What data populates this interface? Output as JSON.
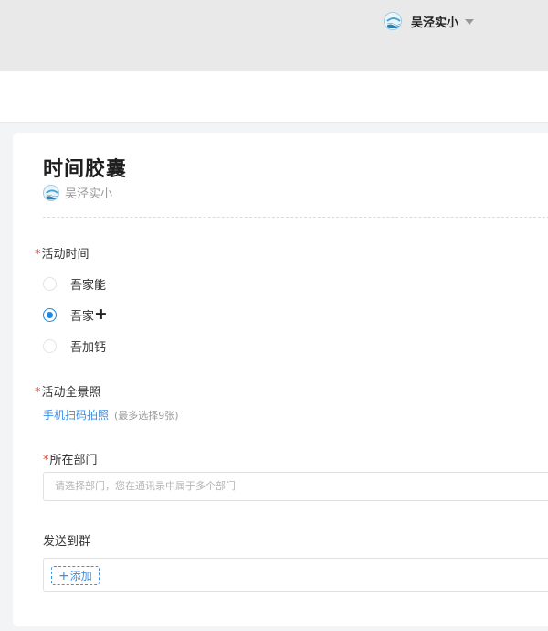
{
  "header": {
    "account_name": "吴泾实小"
  },
  "form": {
    "title": "时间胶囊",
    "org_name": "吴泾实小",
    "activity_time": {
      "label": "活动时间",
      "options": [
        {
          "label": "吾家能",
          "checked": false
        },
        {
          "label": "吾家",
          "checked": true
        },
        {
          "label": "吾加钙",
          "checked": false
        }
      ]
    },
    "photo": {
      "label": "活动全景照",
      "upload_link": "手机扫码拍照",
      "hint": "(最多选择9张)"
    },
    "department": {
      "label": "所在部门",
      "placeholder": "请选择部门，您在通讯录中属于多个部门"
    },
    "send_to_group": {
      "label": "发送到群",
      "add_label": "添加"
    }
  },
  "colors": {
    "accent": "#1e88e5",
    "link": "#3b8fe6",
    "required": "#e0483e"
  }
}
